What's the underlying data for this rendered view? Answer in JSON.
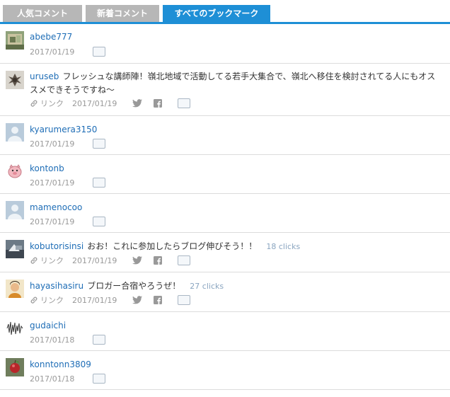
{
  "tabs": [
    {
      "label": "人気コメント"
    },
    {
      "label": "新着コメント"
    },
    {
      "label": "すべてのブックマーク"
    }
  ],
  "entries": [
    {
      "user": "abebe777",
      "date": "2017/01/19"
    },
    {
      "user": "uruseb",
      "comment": "フレッシュな講師陣！嶺北地域で活動してる若手大集合で、嶺北へ移住を検討されてる人にもオススメできそうですね〜",
      "link_label": "リンク",
      "date": "2017/01/19"
    },
    {
      "user": "kyarumera3150",
      "date": "2017/01/19"
    },
    {
      "user": "kontonb",
      "date": "2017/01/19"
    },
    {
      "user": "mamenocoo",
      "date": "2017/01/19"
    },
    {
      "user": "kobutorisinsi",
      "comment": "おお！これに参加したらブログ伸びそう！！",
      "clicks": "18 clicks",
      "link_label": "リンク",
      "date": "2017/01/19"
    },
    {
      "user": "hayasihasiru",
      "comment": "ブロガー合宿やろうぜ！",
      "clicks": "27 clicks",
      "link_label": "リンク",
      "date": "2017/01/19"
    },
    {
      "user": "gudaichi",
      "date": "2017/01/18"
    },
    {
      "user": "konntonn3809",
      "date": "2017/01/18"
    }
  ],
  "colors": {
    "accent": "#1e8fd6",
    "tab_inactive": "#b7b7b7",
    "username": "#1e6db6"
  }
}
